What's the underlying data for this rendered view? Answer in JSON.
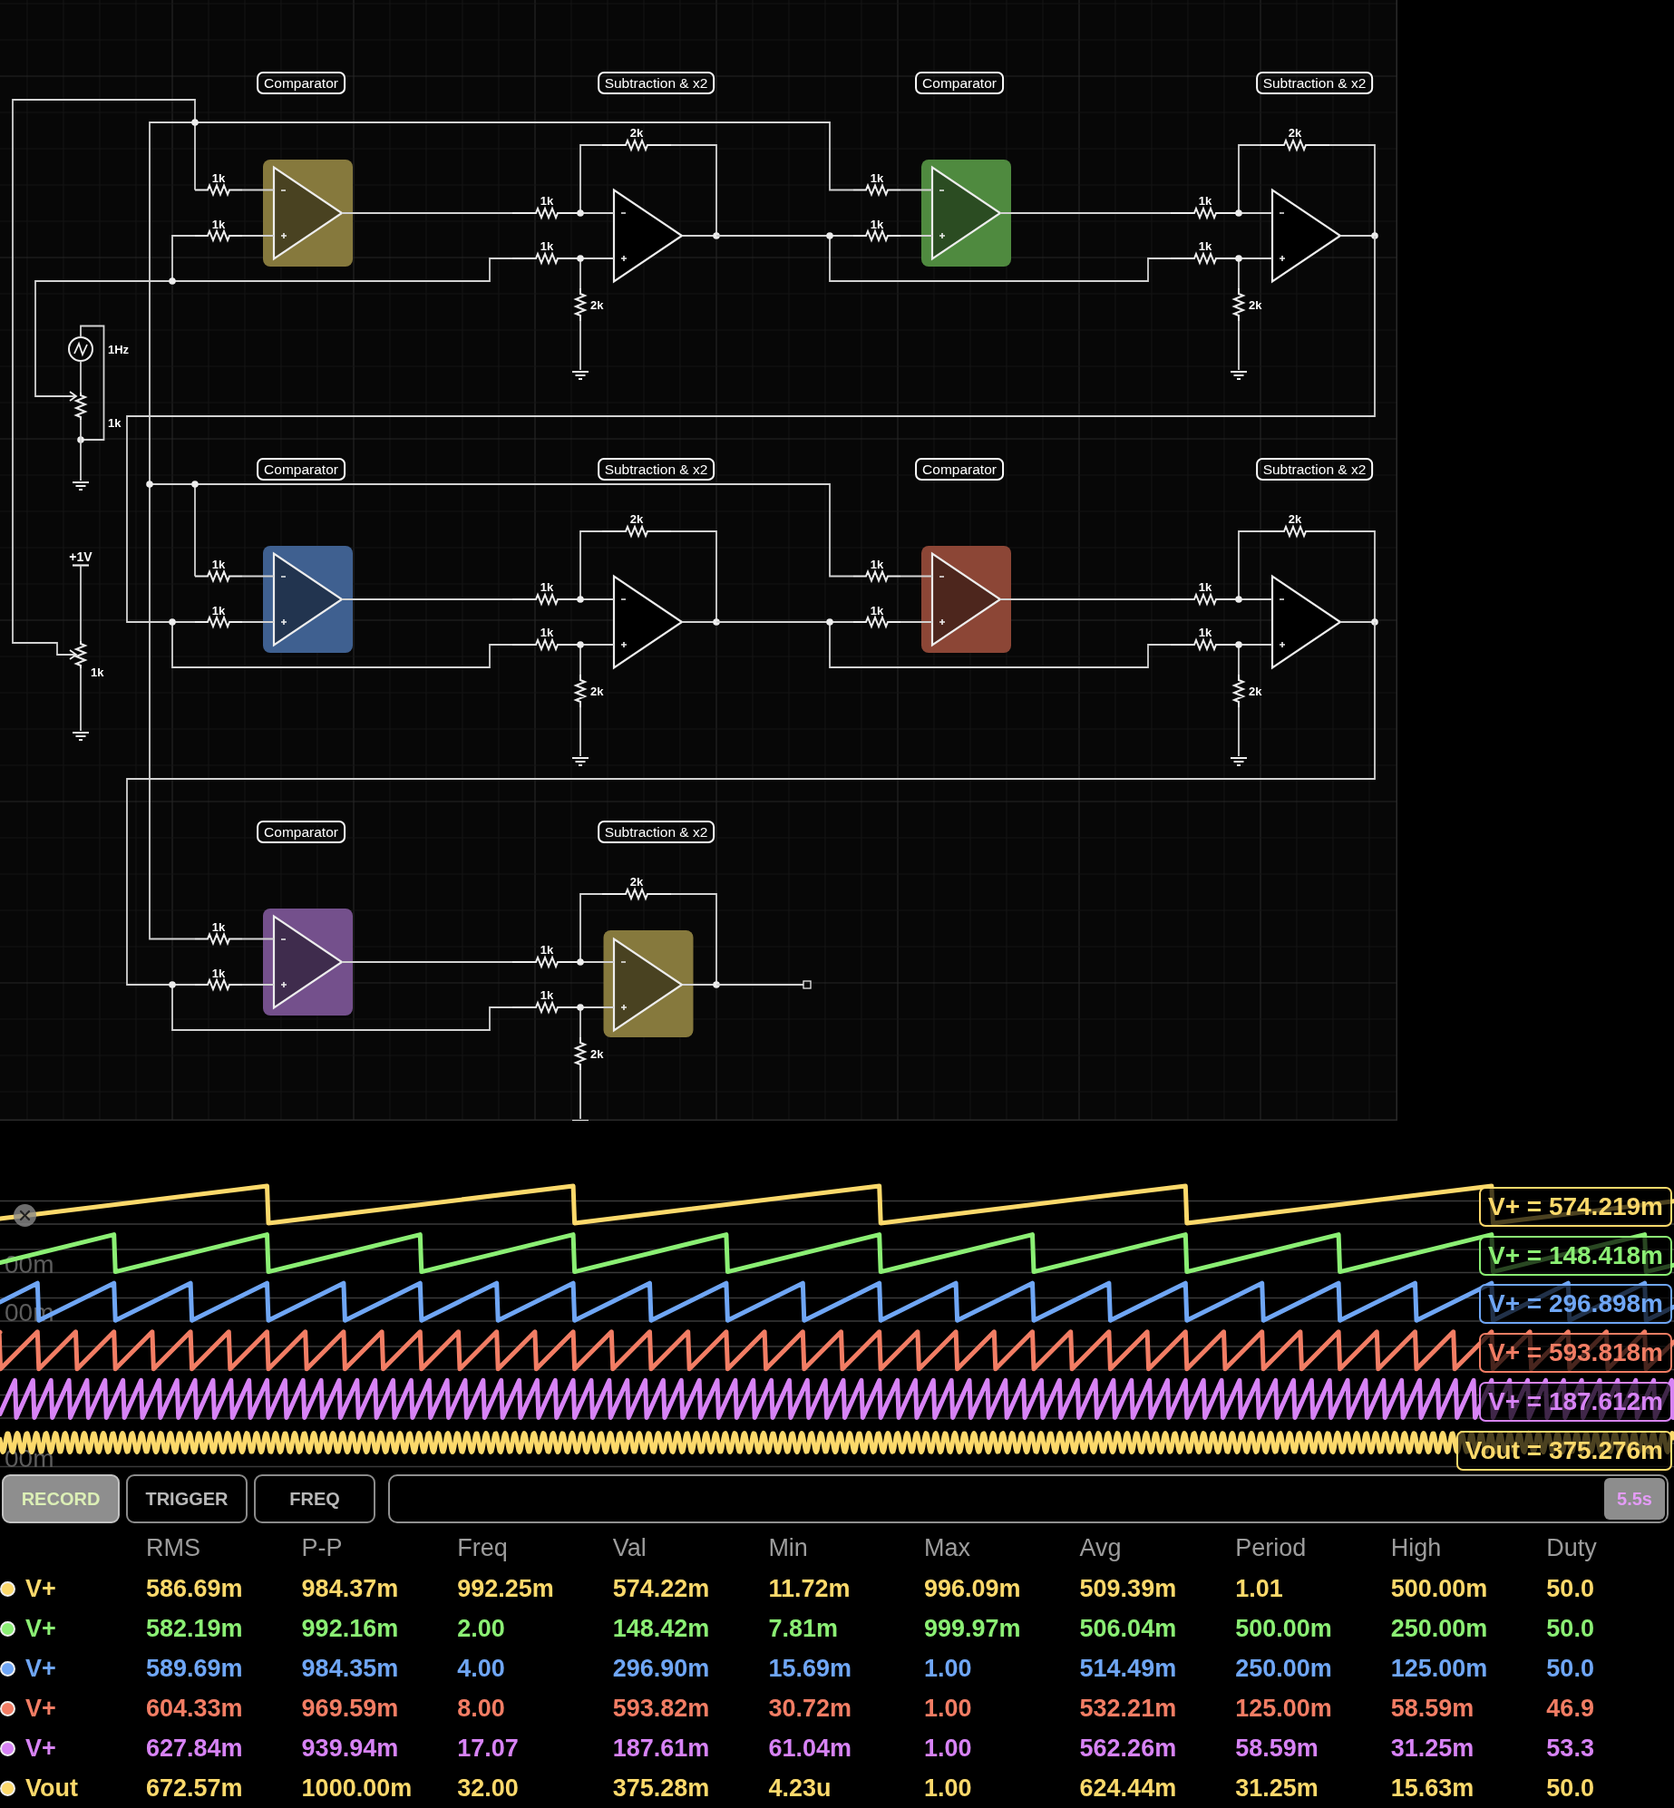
{
  "schematic": {
    "stages": [
      {
        "comparator": {
          "title": "Comparator",
          "color": "#86793d",
          "r_minus": "1k",
          "r_plus": "1k"
        },
        "subtractor": {
          "title": "Subtraction & x2",
          "r_feedback": "2k",
          "r_minus": "1k",
          "r_plus": "1k",
          "r_ground": "2k"
        }
      },
      {
        "comparator": {
          "title": "Comparator",
          "color": "#4f8a3f",
          "r_minus": "1k",
          "r_plus": "1k"
        },
        "subtractor": {
          "title": "Subtraction & x2",
          "r_feedback": "2k",
          "r_minus": "1k",
          "r_plus": "1k",
          "r_ground": "2k"
        }
      },
      {
        "comparator": {
          "title": "Comparator",
          "color": "#3f6090",
          "r_minus": "1k",
          "r_plus": "1k"
        },
        "subtractor": {
          "title": "Subtraction & x2",
          "r_feedback": "2k",
          "r_minus": "1k",
          "r_plus": "1k",
          "r_ground": "2k"
        }
      },
      {
        "comparator": {
          "title": "Comparator",
          "color": "#8c4636",
          "r_minus": "1k",
          "r_plus": "1k"
        },
        "subtractor": {
          "title": "Subtraction & x2",
          "r_feedback": "2k",
          "r_minus": "1k",
          "r_plus": "1k",
          "r_ground": "2k"
        }
      },
      {
        "comparator": {
          "title": "Comparator",
          "color": "#74508c",
          "r_minus": "1k",
          "r_plus": "1k"
        },
        "subtractor": {
          "title": "Subtraction & x2",
          "color": "#86793d",
          "r_feedback": "2k",
          "r_minus": "1k",
          "r_plus": "1k",
          "r_ground": "2k"
        }
      }
    ],
    "sources": [
      {
        "kind": "signal",
        "label": "1Hz",
        "pot": "1k"
      },
      {
        "kind": "rail",
        "label": "+1V",
        "pot": "1k"
      }
    ]
  },
  "channels": [
    {
      "name": "V+",
      "color": "#fcd96b",
      "reading": "V+ = 574.219m",
      "values": [
        "586.69m",
        "984.37m",
        "992.25m",
        "574.22m",
        "11.72m",
        "996.09m",
        "509.39m",
        "1.01",
        "500.00m",
        "50.0"
      ]
    },
    {
      "name": "V+",
      "color": "#8bef74",
      "axis_label": "00m",
      "reading": "V+ = 148.418m",
      "values": [
        "582.19m",
        "992.16m",
        "2.00",
        "148.42m",
        "7.81m",
        "999.97m",
        "506.04m",
        "500.00m",
        "250.00m",
        "50.0"
      ]
    },
    {
      "name": "V+",
      "color": "#6fa6f5",
      "axis_label": "00m",
      "reading": "V+ = 296.898m",
      "values": [
        "589.69m",
        "984.35m",
        "4.00",
        "296.90m",
        "15.69m",
        "1.00",
        "514.49m",
        "250.00m",
        "125.00m",
        "50.0"
      ]
    },
    {
      "name": "V+",
      "color": "#f27d64",
      "reading": "V+ = 593.818m",
      "values": [
        "604.33m",
        "969.59m",
        "8.00",
        "593.82m",
        "30.72m",
        "1.00",
        "532.21m",
        "125.00m",
        "58.59m",
        "46.9"
      ]
    },
    {
      "name": "V+",
      "color": "#d783f5",
      "reading": "V+ = 187.612m",
      "values": [
        "627.84m",
        "939.94m",
        "17.07",
        "187.61m",
        "61.04m",
        "1.00",
        "562.26m",
        "58.59m",
        "31.25m",
        "53.3"
      ]
    },
    {
      "name": "Vout",
      "color": "#fcd96b",
      "axis_label": "00m",
      "reading": "Vout = 375.276m",
      "values": [
        "672.57m",
        "1000.00m",
        "32.00",
        "375.28m",
        "4.23u",
        "1.00",
        "624.44m",
        "31.25m",
        "15.63m",
        "50.0"
      ]
    }
  ],
  "scope": {
    "controls": [
      {
        "label": "RECORD",
        "on": true
      },
      {
        "label": "TRIGGER",
        "on": false
      },
      {
        "label": "FREQ",
        "on": false
      }
    ],
    "time_window": "5.5s"
  },
  "measurements": {
    "columns": [
      "RMS",
      "P-P",
      "Freq",
      "Val",
      "Min",
      "Max",
      "Avg",
      "Period",
      "High",
      "Duty"
    ]
  }
}
